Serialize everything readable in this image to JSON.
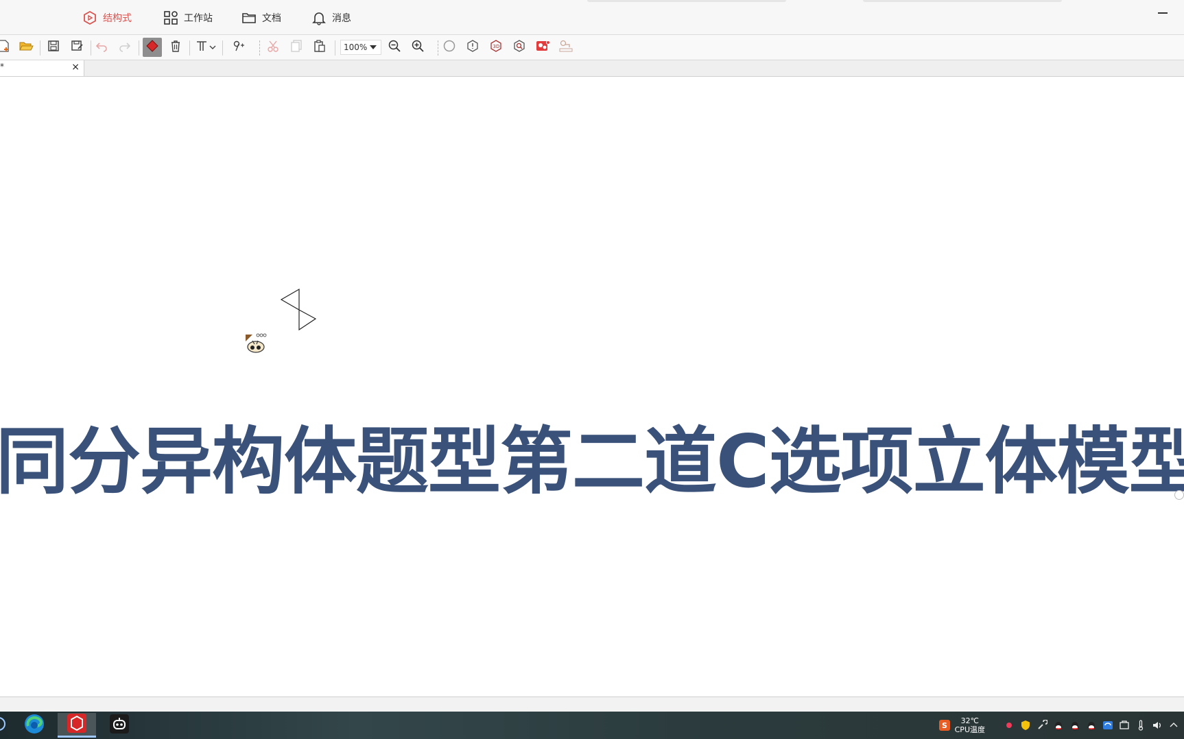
{
  "topnav": {
    "items": [
      {
        "label": "结构式",
        "icon": "hexagon-icon",
        "active": true
      },
      {
        "label": "工作站",
        "icon": "grid-icon",
        "active": false
      },
      {
        "label": "文档",
        "icon": "folder-icon",
        "active": false
      },
      {
        "label": "消息",
        "icon": "bell-icon",
        "active": false
      }
    ],
    "accent": "#d9534f"
  },
  "toolbar": {
    "zoom": "100%",
    "buttons": [
      "new-icon",
      "open-icon",
      "save-icon",
      "save-as-icon",
      "undo-icon",
      "redo-icon",
      "eraser-icon",
      "delete-icon",
      "text-icon",
      "chevron-down-icon",
      "formula-icon",
      "cut-icon",
      "copy-icon",
      "paste-icon",
      "zoom-out-icon",
      "zoom-in-icon",
      "circle-icon",
      "info-icon",
      "3d-icon",
      "search-mol-icon",
      "image-icon",
      "name-icon"
    ]
  },
  "document": {
    "tab_label": "*",
    "close_glyph": "×"
  },
  "canvas": {
    "headline": "同分异构体题型第二道C选项立体模型",
    "headline_color": "#3a5179"
  },
  "taskbar": {
    "cpu_temp": "32℃",
    "cpu_label": "CPU温度"
  }
}
